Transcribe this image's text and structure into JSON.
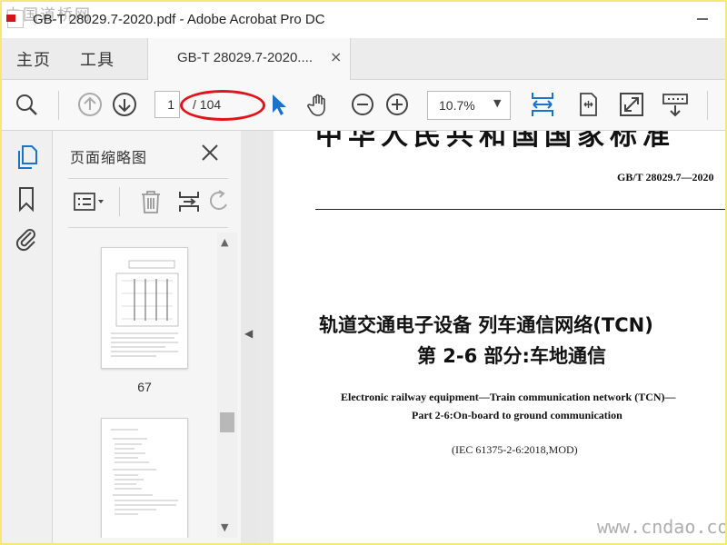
{
  "window": {
    "title": "GB-T 28029.7-2020.pdf - Adobe Acrobat Pro DC",
    "watermark_top": "中国道桥网",
    "watermark_bottom": "www.cndao.com"
  },
  "tabs": {
    "home": "主页",
    "tools": "工具",
    "document": "GB-T 28029.7-2020....",
    "close_symbol": "×"
  },
  "toolbar": {
    "current_page": "1",
    "total_pages": "/ 104",
    "zoom": "10.7%",
    "icons": [
      "search-icon",
      "previous-page-icon",
      "next-page-icon",
      "select-pointer-icon",
      "hand-tool-icon",
      "zoom-out-icon",
      "zoom-in-icon",
      "fit-width-icon",
      "rotate-page-icon",
      "full-screen-icon",
      "scroll-mode-icon"
    ]
  },
  "left_rail": {
    "icons": [
      "page-thumbnails-icon",
      "bookmarks-icon",
      "attachments-icon"
    ]
  },
  "thumbnail_panel": {
    "title": "页面缩略图",
    "thumbnails": [
      {
        "label": "67"
      },
      {
        "label": ""
      }
    ]
  },
  "document": {
    "header_title": "中华人民共和国国家标准",
    "standard_number": "GB/T  28029.7—2020",
    "title_cn_line1": "轨道交通电子设备    列车通信网络(TCN)",
    "title_cn_line2": "第 2-6 部分:车地通信",
    "title_en_line1": "Electronic railway equipment—Train communication network (TCN)—",
    "title_en_line2": "Part 2-6:On-board to ground communication",
    "iec_reference": "(IEC 61375-2-6:2018,MOD)"
  },
  "colors": {
    "accent_blue": "#1a73c9",
    "annotation_red": "#e0141a",
    "border_yellow": "#f5e87a"
  }
}
